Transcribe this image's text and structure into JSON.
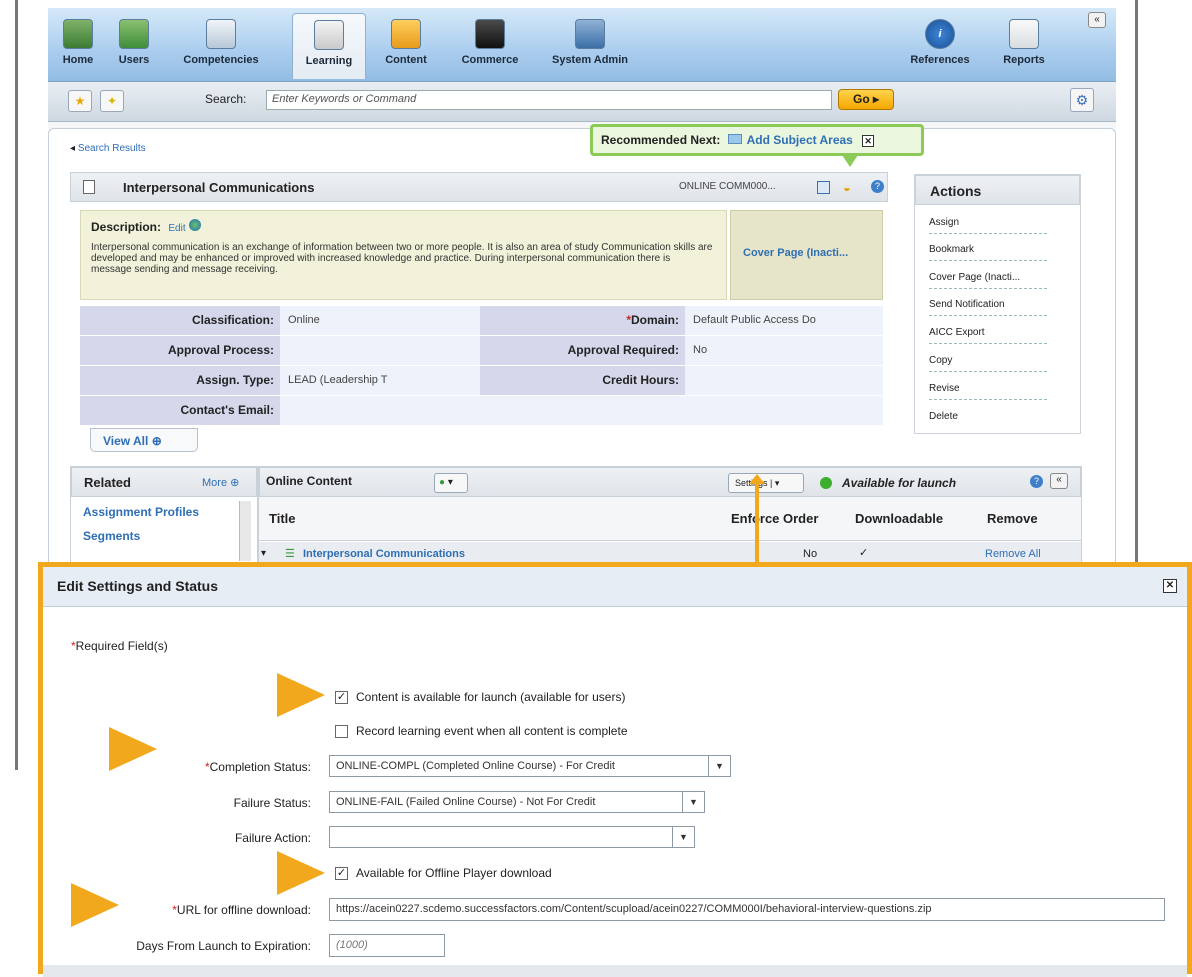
{
  "nav": {
    "items": [
      {
        "label": "Home",
        "icon": "home-icon"
      },
      {
        "label": "Users",
        "icon": "users-icon"
      },
      {
        "label": "Competencies",
        "icon": "competencies-icon"
      },
      {
        "label": "Learning",
        "icon": "learning-icon"
      },
      {
        "label": "Content",
        "icon": "folder-icon"
      },
      {
        "label": "Commerce",
        "icon": "briefcase-icon"
      },
      {
        "label": "System Admin",
        "icon": "admin-icon"
      },
      {
        "label": "References",
        "icon": "info-icon"
      },
      {
        "label": "Reports",
        "icon": "chart-icon"
      }
    ],
    "active": "Learning",
    "collapse": "«"
  },
  "search": {
    "label": "Search:",
    "placeholder": "Enter Keywords or Command",
    "go": "Go ▸"
  },
  "breadcrumb": "Search Results",
  "recommended": {
    "label": "Recommended Next:",
    "link": "Add Subject Areas"
  },
  "item": {
    "title": "Interpersonal Communications",
    "code": "ONLINE COMM000..."
  },
  "description": {
    "label": "Description:",
    "edit": "Edit",
    "text": "Interpersonal communication is an exchange of information between two or more people. It is also an area of study Communication skills are developed and may be enhanced or improved with increased knowledge and practice. During interpersonal communication there is message sending and message receiving.",
    "cover": "Cover Page (Inacti..."
  },
  "details": {
    "classification_label": "Classification:",
    "classification": "Online",
    "domain_label": "Domain:",
    "domain": "Default Public Access Do",
    "approval_process_label": "Approval Process:",
    "approval_process": "",
    "approval_required_label": "Approval Required:",
    "approval_required": "No",
    "assign_type_label": "Assign. Type:",
    "assign_type": "LEAD (Leadership T",
    "credit_hours_label": "Credit Hours:",
    "credit_hours": "",
    "contact_email_label": "Contact's Email:",
    "contact_email": ""
  },
  "view_all": "View All",
  "actions": {
    "title": "Actions",
    "items": [
      "Assign",
      "Bookmark",
      "Cover Page (Inacti...",
      "Send Notification",
      "AICC Export",
      "Copy",
      "Revise",
      "Delete"
    ]
  },
  "related": {
    "title": "Related",
    "more": "More",
    "items": [
      "Assignment Profiles",
      "Segments"
    ]
  },
  "online_content": {
    "title": "Online Content",
    "settings": "Settings",
    "status": "Available for launch",
    "columns": [
      "Title",
      "Enforce Order",
      "Downloadable",
      "Remove"
    ],
    "row": {
      "title": "Interpersonal Communications",
      "enforce": "No",
      "downloadable": "✓",
      "remove": "Remove All"
    }
  },
  "dialog": {
    "title": "Edit Settings and Status",
    "required_note": "Required Field(s)",
    "content_available": "Content is available for launch (available for users)",
    "record_event": "Record learning event when all content is complete",
    "completion_status_label": "Completion Status:",
    "completion_status": "ONLINE-COMPL (Completed Online Course) - For Credit",
    "failure_status_label": "Failure Status:",
    "failure_status": "ONLINE-FAIL (Failed Online Course) - Not For Credit",
    "failure_action_label": "Failure Action:",
    "failure_action": "",
    "offline_available": "Available for Offline Player download",
    "url_label": "URL for offline download:",
    "url": "https://acein0227.scdemo.successfactors.com/Content/scupload/acein0227/COMM000I/behavioral-interview-questions.zip",
    "days_label": "Days From Launch to Expiration:",
    "days_placeholder": "(1000)"
  },
  "colors": {
    "accent": "#f2a81d",
    "link": "#2f6fb4",
    "required": "#d0211c"
  }
}
